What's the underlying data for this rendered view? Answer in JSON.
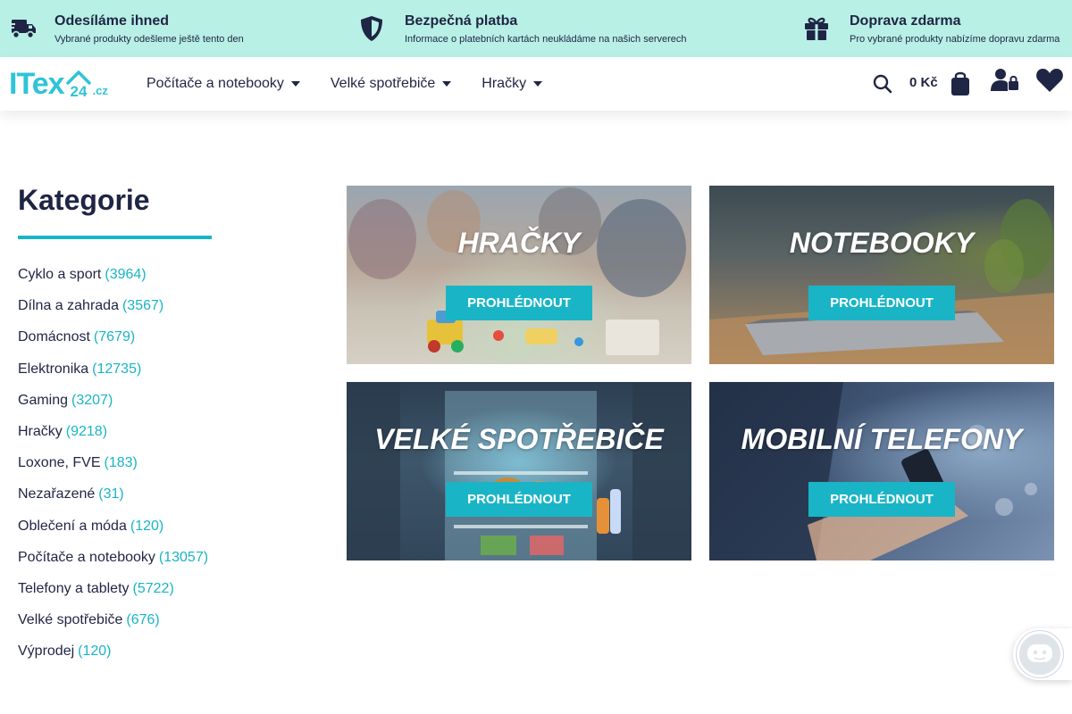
{
  "topbar": {
    "items": [
      {
        "title": "Odesíláme ihned",
        "sub": "Vybrané produkty odešleme ještě tento den",
        "icon": "truck-fast-icon"
      },
      {
        "title": "Bezpečná platba",
        "sub": "Informace o platebních kartách neukládáme na našich serverech",
        "icon": "shield-icon"
      },
      {
        "title": "Doprava zdarma",
        "sub": "Pro vybrané produkty nabízíme dopravu zdarma",
        "icon": "gift-icon"
      }
    ]
  },
  "header": {
    "logo_text": "ITex",
    "logo_digit": "24",
    "logo_cz": ".cz",
    "nav": [
      {
        "label": "Počítače a notebooky"
      },
      {
        "label": "Velké spotřebiče"
      },
      {
        "label": "Hračky"
      }
    ],
    "cart_total": "0 Kč"
  },
  "sidebar": {
    "title": "Kategorie",
    "categories": [
      {
        "name": "Cyklo a sport",
        "count": "(3964)"
      },
      {
        "name": "Dílna a zahrada",
        "count": "(3567)"
      },
      {
        "name": "Domácnost",
        "count": "(7679)"
      },
      {
        "name": "Elektronika",
        "count": "(12735)"
      },
      {
        "name": "Gaming",
        "count": "(3207)"
      },
      {
        "name": "Hračky",
        "count": "(9218)"
      },
      {
        "name": "Loxone, FVE",
        "count": "(183)"
      },
      {
        "name": "Nezařazené",
        "count": "(31)"
      },
      {
        "name": "Oblečení a móda",
        "count": "(120)"
      },
      {
        "name": "Počítače a notebooky",
        "count": "(13057)"
      },
      {
        "name": "Telefony a tablety",
        "count": "(5722)"
      },
      {
        "name": "Velké spotřebiče",
        "count": "(676)"
      },
      {
        "name": "Výprodej",
        "count": "(120)"
      }
    ]
  },
  "tiles": [
    {
      "title": "HRAČKY",
      "button": "PROHLÉDNOUT"
    },
    {
      "title": "NOTEBOOKY",
      "button": "PROHLÉDNOUT"
    },
    {
      "title": "VELKÉ SPOTŘEBIČE",
      "button": "PROHLÉDNOUT"
    },
    {
      "title": "MOBILNÍ TELEFONY",
      "button": "PROHLÉDNOUT"
    }
  ],
  "colors": {
    "accent": "#19b5c6",
    "topbar_bg": "#b8f0e6",
    "text_dark": "#1f2544"
  }
}
